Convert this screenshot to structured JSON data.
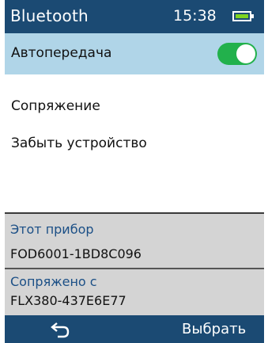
{
  "status_bar": {
    "title": "Bluetooth",
    "time": "15:38",
    "battery_icon": "battery-icon"
  },
  "menu": {
    "auto_transfer": {
      "label": "Автопередача",
      "toggle_on": true,
      "toggle_color": "#22b14c"
    },
    "pair_label": "Сопряжение",
    "forget_label": "Забыть устройство"
  },
  "this_device": {
    "caption": "Этот прибор",
    "value": "FOD6001-1BD8C096"
  },
  "paired_with": {
    "caption": "Сопряжено с",
    "value": "FLX380-437E6E77"
  },
  "bottom_bar": {
    "back_icon": "back-arrow-icon",
    "select_label": "Выбрать"
  },
  "colors": {
    "header_bg": "#1b4a73",
    "selected_row_bg": "#b0d5e8",
    "panel_bg": "#d4d4d4",
    "caption_text": "#1b4f86"
  }
}
